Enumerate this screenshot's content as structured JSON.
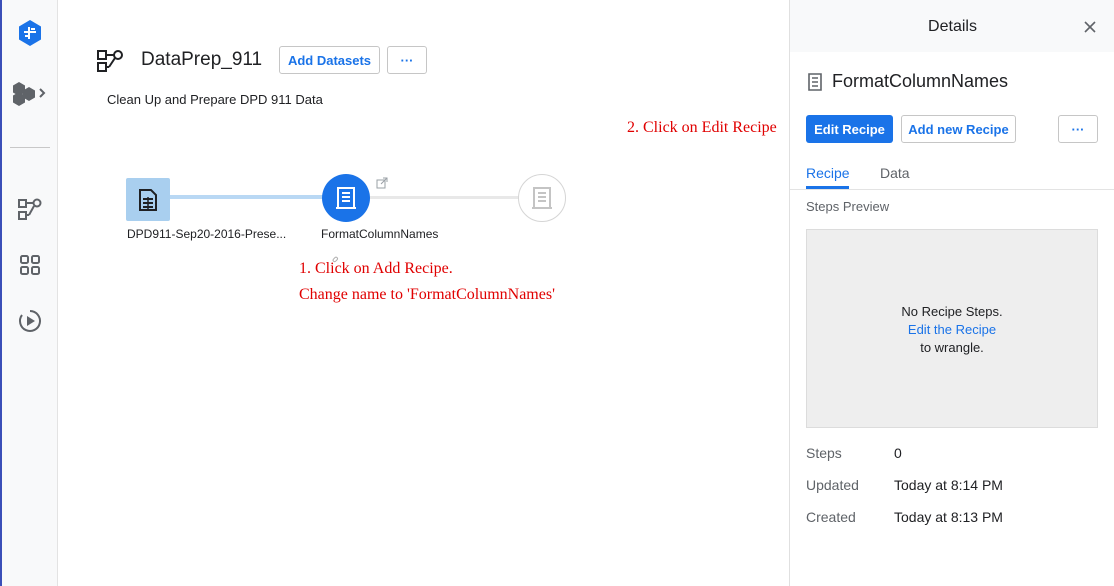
{
  "flow": {
    "title": "DataPrep_911",
    "description": "Clean Up and Prepare DPD 911 Data",
    "add_datasets_label": "Add Datasets",
    "more_label": "···"
  },
  "canvas": {
    "dataset_label": "DPD911-Sep20-2016-Prese...",
    "recipe_label": "FormatColumnNames"
  },
  "annotations": {
    "step1_line1": "1. Click on Add Recipe.",
    "step1_line2": "Change name to 'FormatColumnNames'",
    "step2": "2. Click on Edit Recipe"
  },
  "details": {
    "title": "Details",
    "recipe_name": "FormatColumnNames",
    "edit_recipe_label": "Edit Recipe",
    "add_new_recipe_label": "Add new Recipe",
    "more_label": "···",
    "tabs": [
      {
        "label": "Recipe"
      },
      {
        "label": "Data"
      }
    ],
    "steps_preview_label": "Steps Preview",
    "preview": {
      "line1": "No Recipe Steps.",
      "link": "Edit the Recipe",
      "line3": "to wrangle."
    },
    "meta": [
      {
        "key": "Steps",
        "value": "0"
      },
      {
        "key": "Updated",
        "value": "Today at 8:14 PM"
      },
      {
        "key": "Created",
        "value": "Today at 8:13 PM"
      }
    ]
  },
  "colors": {
    "accent": "#1a73e8",
    "annotation": "#e00000",
    "dataset_node": "#a9cfef"
  },
  "icons": {
    "logo": "dataprep-logo-icon",
    "sidebar": [
      "product-switcher-icon",
      "flows-icon",
      "datasets-icon",
      "jobs-icon"
    ],
    "close": "close-icon"
  }
}
